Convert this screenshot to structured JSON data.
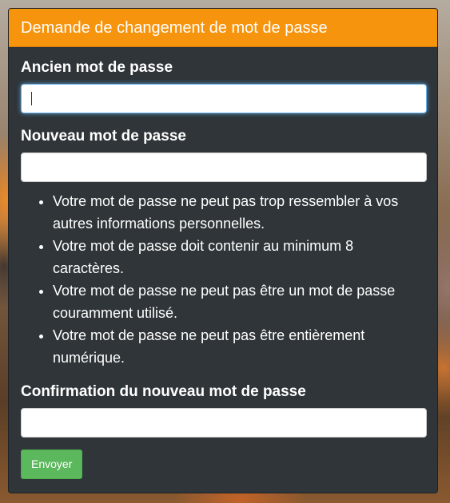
{
  "panel": {
    "title": "Demande de changement de mot de passe"
  },
  "form": {
    "old_password": {
      "label": "Ancien mot de passe",
      "value": ""
    },
    "new_password": {
      "label": "Nouveau mot de passe",
      "value": "",
      "help": [
        "Votre mot de passe ne peut pas trop ressembler à vos autres informations personnelles.",
        "Votre mot de passe doit contenir au minimum 8 caractères.",
        "Votre mot de passe ne peut pas être un mot de passe couramment utilisé.",
        "Votre mot de passe ne peut pas être entièrement numérique."
      ]
    },
    "confirm_password": {
      "label": "Confirmation du nouveau mot de passe",
      "value": ""
    },
    "submit_label": "Envoyer"
  },
  "colors": {
    "header": "#f7940e",
    "panel_bg": "#2f3539",
    "submit": "#5cb85c"
  }
}
